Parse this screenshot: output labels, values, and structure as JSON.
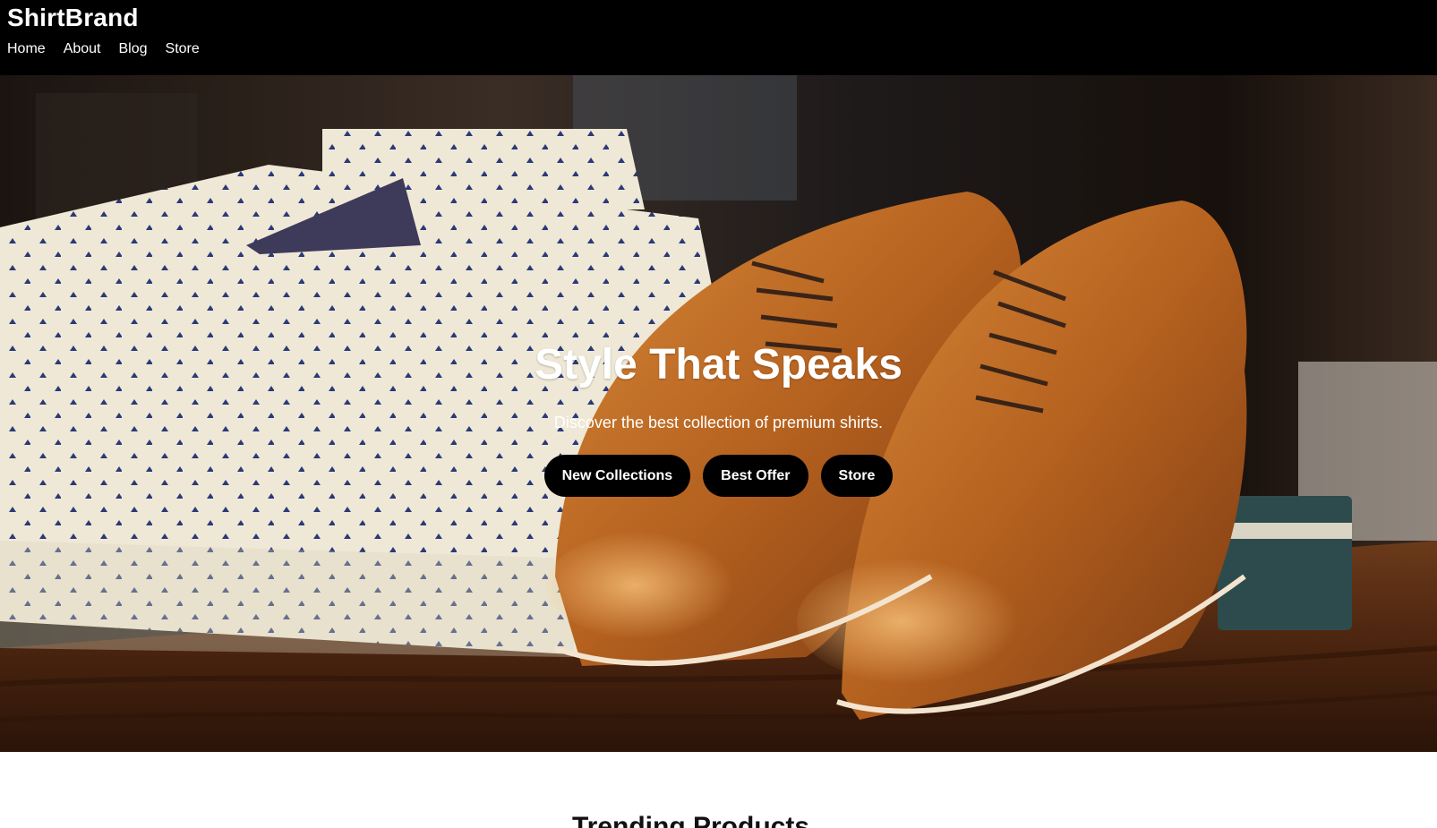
{
  "header": {
    "brand": "ShirtBrand",
    "nav": [
      "Home",
      "About",
      "Blog",
      "Store"
    ]
  },
  "hero": {
    "title": "Style That Speaks",
    "subtitle": "Discover the best collection of premium shirts.",
    "buttons": [
      "New Collections",
      "Best Offer",
      "Store"
    ],
    "image": "photo of folded patterned shirts and brown leather oxford shoes on a wooden table"
  },
  "trending": {
    "title": "Trending Products"
  },
  "colors": {
    "header_bg": "#000000",
    "button_bg": "#000000",
    "text_light": "#ffffff"
  }
}
